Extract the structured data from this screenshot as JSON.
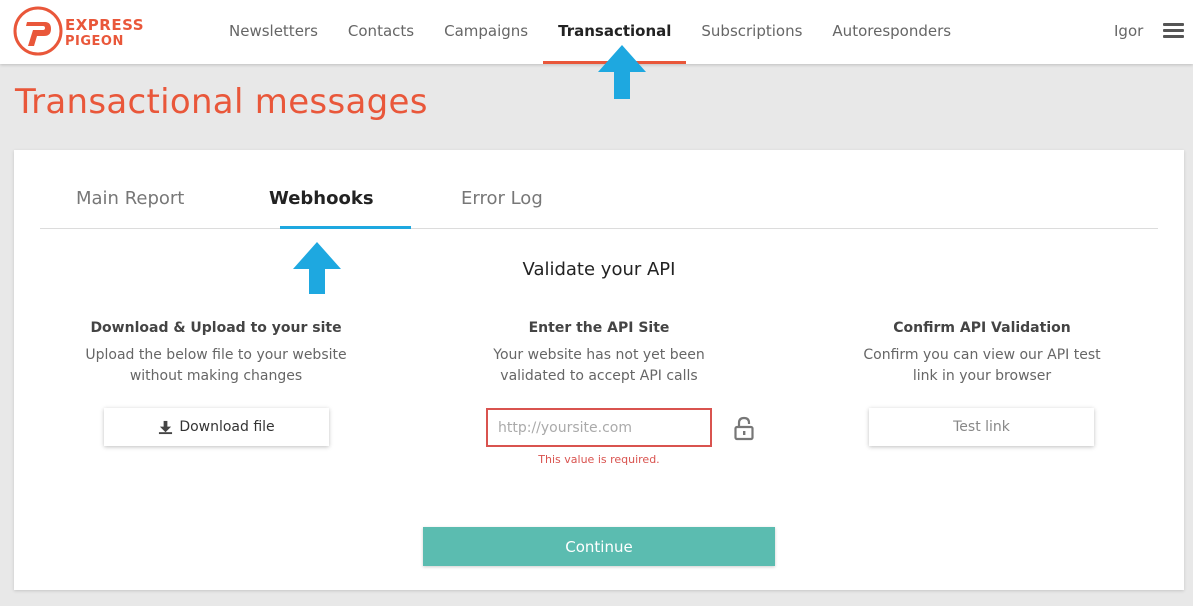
{
  "brand": {
    "logo_line1": "EXPRESS",
    "logo_line2": "PIGEON",
    "color": "#e9573a"
  },
  "nav": {
    "items": [
      {
        "label": "Newsletters",
        "active": false
      },
      {
        "label": "Contacts",
        "active": false
      },
      {
        "label": "Campaigns",
        "active": false
      },
      {
        "label": "Transactional",
        "active": true
      },
      {
        "label": "Subscriptions",
        "active": false
      },
      {
        "label": "Autoresponders",
        "active": false
      }
    ],
    "user": "Igor",
    "menu_icon": "hamburger-icon"
  },
  "page": {
    "title": "Transactional messages"
  },
  "tabs": [
    {
      "label": "Main Report",
      "active": false
    },
    {
      "label": "Webhooks",
      "active": true
    },
    {
      "label": "Error Log",
      "active": false
    }
  ],
  "webhooks": {
    "section_title": "Validate your API",
    "columns": [
      {
        "title": "Download & Upload to your site",
        "desc_line1": "Upload the below file to your website",
        "desc_line2": "without making changes"
      },
      {
        "title": "Enter the API Site",
        "desc_line1": "Your website has not yet been",
        "desc_line2": "validated to accept API calls"
      },
      {
        "title": "Confirm API Validation",
        "desc_line1": "Confirm you can view our API test",
        "desc_line2": "link in your browser"
      }
    ],
    "download_button": "Download file",
    "api_input": {
      "value": "",
      "placeholder": "http://yoursite.com",
      "error": "This value is required."
    },
    "test_button": "Test link",
    "continue_button": "Continue"
  },
  "colors": {
    "accent": "#e9573a",
    "tab_underline": "#1ea8e0",
    "annotation_arrow": "#1ea8e0",
    "continue_button": "#5bbcb0",
    "error": "#d9534f"
  }
}
